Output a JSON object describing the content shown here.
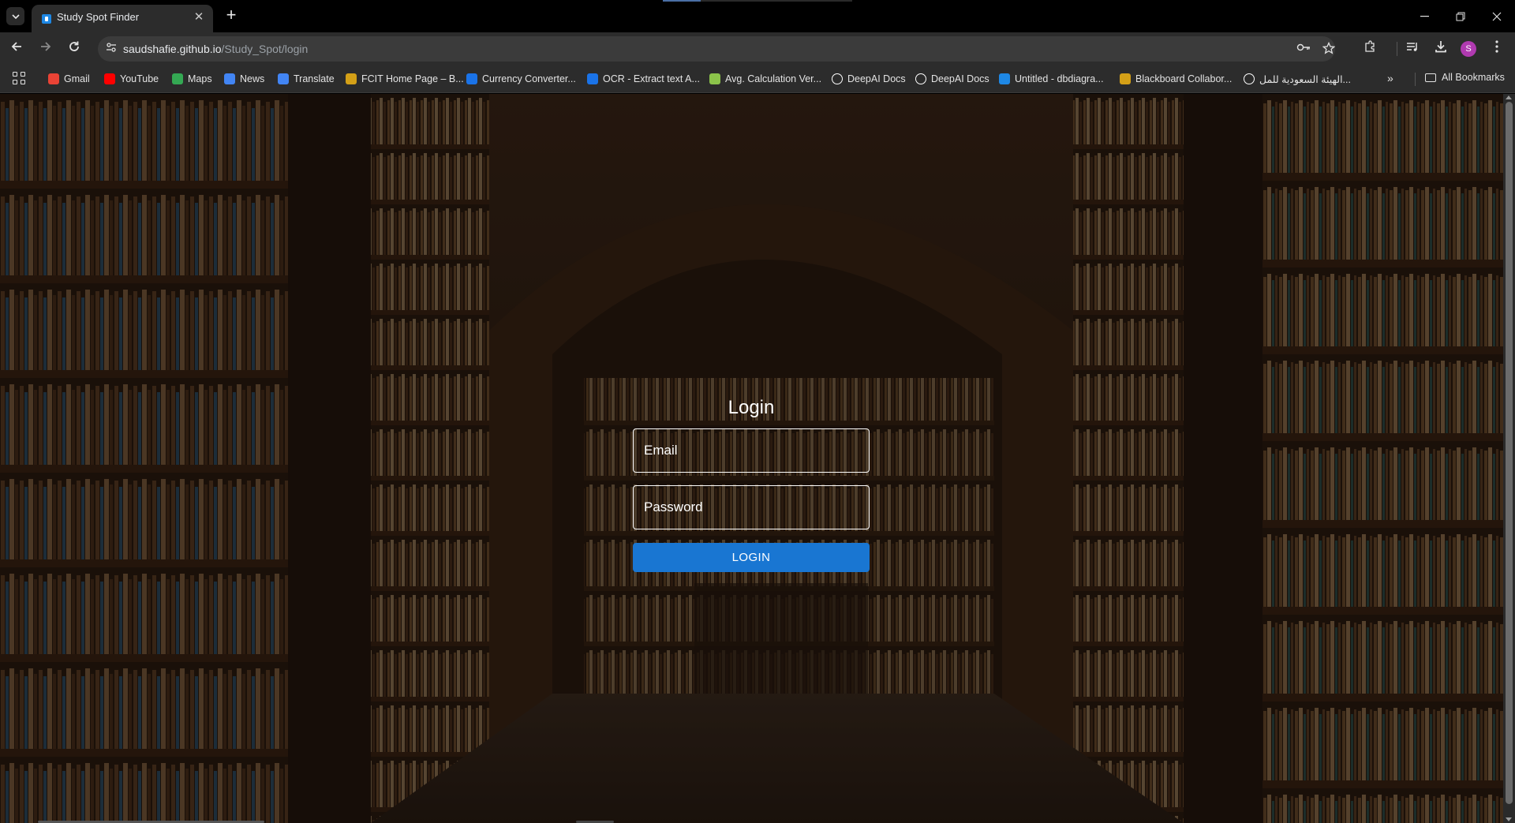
{
  "browser": {
    "tab_title": "Study Spot Finder",
    "close_tab_glyph": "✕",
    "new_tab_glyph": "+",
    "url_host": "saudshafie.github.io",
    "url_path": "/Study_Spot/login",
    "profile_initial": "S",
    "bookmarks": [
      {
        "label": "Gmail",
        "icon": "gmail-icon",
        "color": "#ea4335"
      },
      {
        "label": "YouTube",
        "icon": "youtube-icon",
        "color": "#ff0000"
      },
      {
        "label": "Maps",
        "icon": "maps-icon",
        "color": "#34a853"
      },
      {
        "label": "News",
        "icon": "news-icon",
        "color": "#4285f4"
      },
      {
        "label": "Translate",
        "icon": "translate-icon",
        "color": "#4285f4"
      },
      {
        "label": "FCIT Home Page – B...",
        "icon": "fcit-icon",
        "color": "#d4a017"
      },
      {
        "label": "Currency Converter...",
        "icon": "currency-icon",
        "color": "#1a73e8"
      },
      {
        "label": "OCR - Extract text A...",
        "icon": "ocr-icon",
        "color": "#1a73e8"
      },
      {
        "label": "Avg. Calculation Ver...",
        "icon": "avg-icon",
        "color": "#8bc34a"
      },
      {
        "label": "DeepAI Docs",
        "icon": "deepai-icon",
        "color": "#ffffff"
      },
      {
        "label": "DeepAI Docs",
        "icon": "deepai-icon",
        "color": "#ffffff"
      },
      {
        "label": "Untitled - dbdiagra...",
        "icon": "dbdiagram-icon",
        "color": "#1e88e5"
      },
      {
        "label": "Blackboard Collabor...",
        "icon": "blackboard-icon",
        "color": "#d4a017"
      },
      {
        "label": "الهيئة السعودية للمل...",
        "icon": "globe-icon",
        "color": "#ffffff"
      }
    ],
    "more_bookmarks_glyph": "»",
    "all_bookmarks": "All Bookmarks"
  },
  "login": {
    "title": "Login",
    "email_placeholder": "Email",
    "password_placeholder": "Password",
    "button_label": "LOGIN",
    "button_color": "#1976d2"
  }
}
